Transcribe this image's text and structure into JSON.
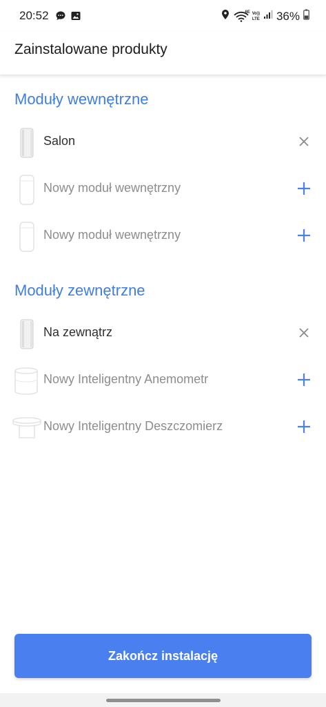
{
  "status_bar": {
    "time": "20:52",
    "left_icons": [
      "chat-bubble-icon",
      "image-icon"
    ],
    "right_icons": [
      "location-icon",
      "wifi-6e-icon",
      "volte-icon",
      "signal-icon",
      "battery-icon"
    ],
    "wifi_label": "6E",
    "volte_label_1": "Vo))",
    "volte_label_2": "LTE",
    "battery": "36%"
  },
  "header": {
    "title": "Zainstalowane produkty"
  },
  "indoor": {
    "title": "Moduły wewnętrzne",
    "items": [
      {
        "label": "Salon",
        "state": "installed",
        "action_icon": "close-icon"
      },
      {
        "label": "Nowy moduł wewnętrzny",
        "state": "available",
        "action_icon": "plus-icon"
      },
      {
        "label": "Nowy moduł wewnętrzny",
        "state": "available",
        "action_icon": "plus-icon"
      }
    ]
  },
  "outdoor": {
    "title": "Moduły zewnętrzne",
    "items": [
      {
        "label": "Na zewnątrz",
        "state": "installed",
        "action_icon": "close-icon"
      },
      {
        "label": "Nowy Inteligentny Anemometr",
        "state": "available",
        "action_icon": "plus-icon"
      },
      {
        "label": "Nowy Inteligentny Deszczomierz",
        "state": "available",
        "action_icon": "plus-icon"
      }
    ]
  },
  "footer": {
    "button_label": "Zakończ instalację"
  },
  "colors": {
    "accent": "#4a7ff0",
    "section_title": "#3f7ee0",
    "muted_text": "#8d8d8d"
  }
}
